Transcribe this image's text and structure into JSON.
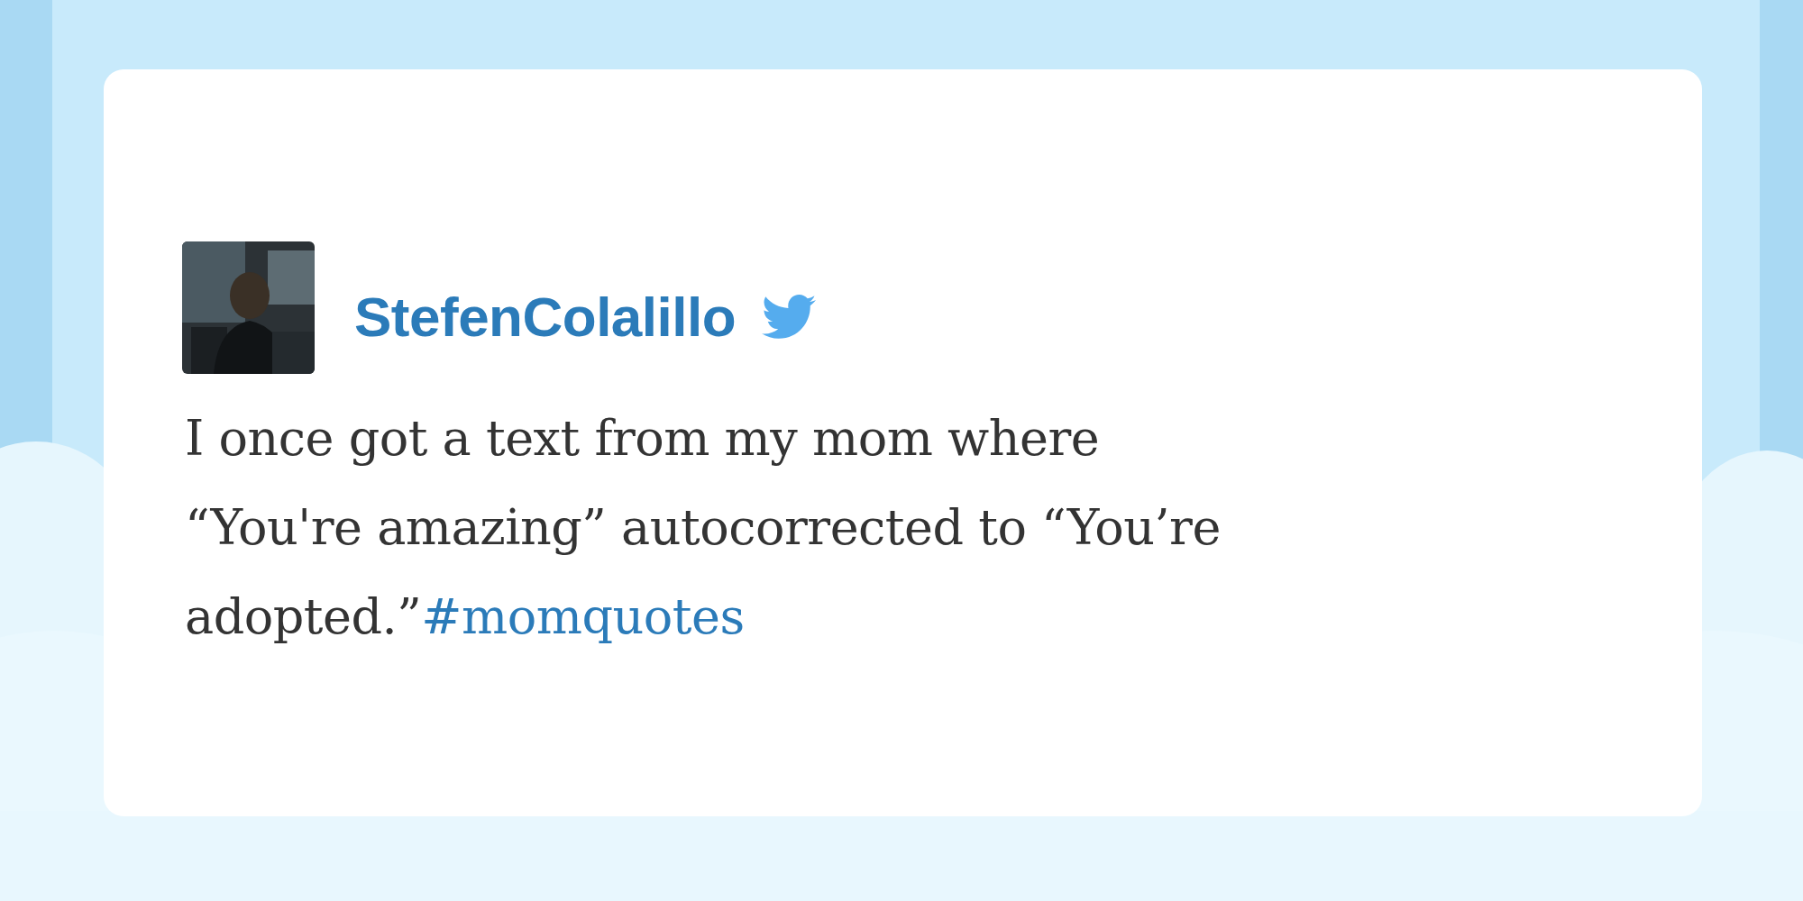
{
  "tweet": {
    "author": "StefenColalillo",
    "text_lines": [
      "I once got a text from my mom where",
      "“You're amazing” autocorrected to “You’re",
      "adopted.”"
    ],
    "hashtag": "#momquotes"
  }
}
